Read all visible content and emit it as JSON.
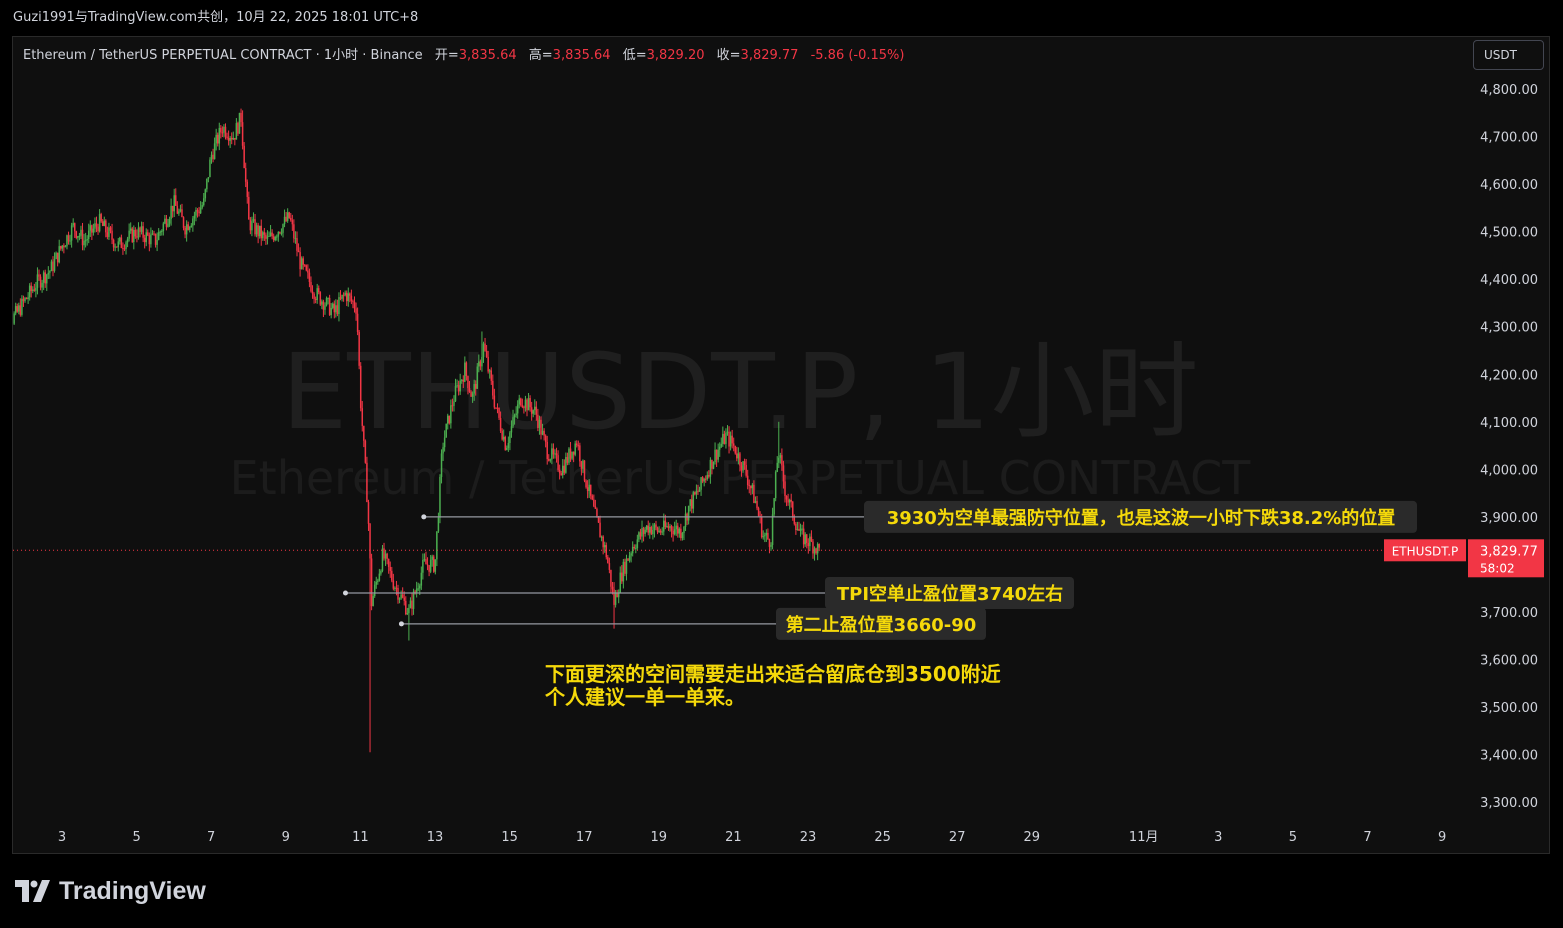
{
  "topbar": {
    "text": "Guzi1991与TradingView.com共创，10月 22, 2025 18:01 UTC+8"
  },
  "legend": {
    "symbol": "Ethereum / TetherUS PERPETUAL CONTRACT · 1小时 · Binance",
    "open_label": "开=",
    "open": "3,835.64",
    "high_label": "高=",
    "high": "3,835.64",
    "low_label": "低=",
    "low": "3,829.20",
    "close_label": "收=",
    "close": "3,829.77",
    "change": "-5.86 (-0.15%)"
  },
  "currency_button": "USDT",
  "watermark": {
    "line1": "ETHUSDT.P, 1小时",
    "line2": "Ethereum / TetherUS PERPETUAL CONTRACT"
  },
  "footer": {
    "brand": "TradingView"
  },
  "colors": {
    "up": "#4caf50",
    "down": "#f23645",
    "annotation_bg": "#2a2a2a",
    "annotation_text": "#f5d90a",
    "price_tag": "#f23645"
  },
  "chart_data": {
    "type": "candlestick",
    "symbol": "ETHUSDT.P",
    "interval": "1小时",
    "ylim": [
      3250,
      4870
    ],
    "y_ticks": [
      "4,800.00",
      "4,700.00",
      "4,600.00",
      "4,500.00",
      "4,400.00",
      "4,300.00",
      "4,200.00",
      "4,100.00",
      "4,000.00",
      "3,900.00",
      "3,700.00",
      "3,600.00",
      "3,500.00",
      "3,400.00",
      "3,300.00"
    ],
    "y_tick_values": [
      4800,
      4700,
      4600,
      4500,
      4400,
      4300,
      4200,
      4100,
      4000,
      3900,
      3700,
      3600,
      3500,
      3400,
      3300
    ],
    "x_ticks": [
      {
        "label": "3",
        "day": 3
      },
      {
        "label": "5",
        "day": 5
      },
      {
        "label": "7",
        "day": 7
      },
      {
        "label": "9",
        "day": 9
      },
      {
        "label": "11",
        "day": 11
      },
      {
        "label": "13",
        "day": 13
      },
      {
        "label": "15",
        "day": 15
      },
      {
        "label": "17",
        "day": 17
      },
      {
        "label": "19",
        "day": 19
      },
      {
        "label": "21",
        "day": 21
      },
      {
        "label": "23",
        "day": 23
      },
      {
        "label": "25",
        "day": 25
      },
      {
        "label": "27",
        "day": 27
      },
      {
        "label": "29",
        "day": 29
      },
      {
        "label": "11月",
        "day": 32
      },
      {
        "label": "3",
        "day": 34
      },
      {
        "label": "5",
        "day": 36
      },
      {
        "label": "7",
        "day": 38
      },
      {
        "label": "9",
        "day": 40
      }
    ],
    "price_anchors": [
      [
        1.3,
        4280
      ],
      [
        1.8,
        4330
      ],
      [
        2.3,
        4390
      ],
      [
        2.7,
        4420
      ],
      [
        3.0,
        4470
      ],
      [
        3.3,
        4510
      ],
      [
        3.6,
        4480
      ],
      [
        4.0,
        4520
      ],
      [
        4.5,
        4470
      ],
      [
        5.0,
        4500
      ],
      [
        5.5,
        4480
      ],
      [
        6.0,
        4560
      ],
      [
        6.3,
        4510
      ],
      [
        6.8,
        4560
      ],
      [
        7.0,
        4660
      ],
      [
        7.3,
        4720
      ],
      [
        7.6,
        4700
      ],
      [
        7.8,
        4740
      ],
      [
        8.0,
        4520
      ],
      [
        8.5,
        4480
      ],
      [
        9.1,
        4530
      ],
      [
        9.4,
        4430
      ],
      [
        9.8,
        4370
      ],
      [
        10.3,
        4330
      ],
      [
        10.6,
        4370
      ],
      [
        10.9,
        4340
      ],
      [
        11.0,
        4150
      ],
      [
        11.2,
        3920
      ],
      [
        11.3,
        3720
      ],
      [
        11.6,
        3820
      ],
      [
        11.9,
        3760
      ],
      [
        12.3,
        3700
      ],
      [
        12.7,
        3800
      ],
      [
        13.0,
        3800
      ],
      [
        13.2,
        4050
      ],
      [
        13.5,
        4150
      ],
      [
        13.8,
        4210
      ],
      [
        14.0,
        4150
      ],
      [
        14.3,
        4260
      ],
      [
        14.6,
        4140
      ],
      [
        14.9,
        4050
      ],
      [
        15.3,
        4150
      ],
      [
        15.7,
        4120
      ],
      [
        16.0,
        4040
      ],
      [
        16.4,
        4000
      ],
      [
        16.8,
        4060
      ],
      [
        17.0,
        3990
      ],
      [
        17.3,
        3900
      ],
      [
        17.6,
        3820
      ],
      [
        17.8,
        3720
      ],
      [
        18.0,
        3780
      ],
      [
        18.3,
        3840
      ],
      [
        18.7,
        3880
      ],
      [
        19.0,
        3870
      ],
      [
        19.3,
        3880
      ],
      [
        19.6,
        3870
      ],
      [
        19.8,
        3920
      ],
      [
        20.1,
        3960
      ],
      [
        20.5,
        4030
      ],
      [
        20.8,
        4070
      ],
      [
        21.0,
        4050
      ],
      [
        21.3,
        4000
      ],
      [
        21.6,
        3930
      ],
      [
        21.8,
        3860
      ],
      [
        22.0,
        3850
      ],
      [
        22.2,
        4040
      ],
      [
        22.4,
        3950
      ],
      [
        22.8,
        3860
      ],
      [
        23.0,
        3850
      ],
      [
        23.3,
        3830
      ]
    ],
    "wick_extremes": [
      {
        "day": 7.85,
        "high": 4755
      },
      {
        "day": 14.25,
        "high": 4290
      },
      {
        "day": 22.2,
        "high": 4100
      },
      {
        "day": 11.25,
        "low": 3405
      },
      {
        "day": 12.3,
        "low": 3640
      },
      {
        "day": 17.8,
        "low": 3665
      }
    ],
    "horizontal_lines": [
      {
        "price": 3900,
        "start_day": 12.7,
        "label": "3930为空单最强防守位置，也是这波一小时下跌38.2%的位置"
      },
      {
        "price": 3740,
        "start_day": 10.6,
        "label": "TPI空单止盈位置3740左右"
      },
      {
        "price": 3675,
        "start_day": 12.1,
        "label": "第二止盈位置3660-90"
      }
    ],
    "note_lines": [
      "下面更深的空间需要走出来适合留底仓到3500附近",
      "个人建议一单一单来。"
    ],
    "current_price": {
      "value": 3829.77,
      "label": "3,829.77",
      "countdown": "58:02",
      "symbol_tag": "ETHUSDT.P"
    }
  }
}
